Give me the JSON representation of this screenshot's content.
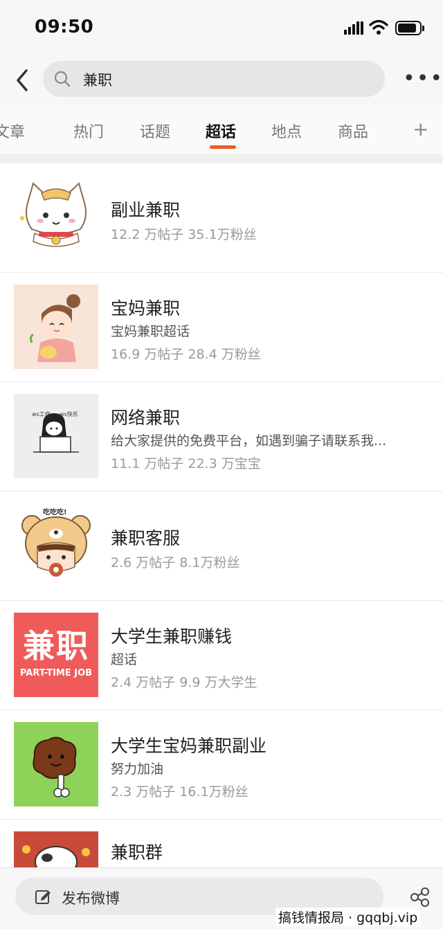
{
  "status_bar": {
    "time": "09:50"
  },
  "search": {
    "query": "兼职"
  },
  "tabs": [
    {
      "label": "文章"
    },
    {
      "label": "热门"
    },
    {
      "label": "话题"
    },
    {
      "label": "超话",
      "active": true
    },
    {
      "label": "地点"
    },
    {
      "label": "商品"
    }
  ],
  "results": [
    {
      "name": "副业兼职",
      "desc": "",
      "stats": "12.2 万帖子 35.1万粉丝",
      "thumb_icon": "cat-mascot-icon"
    },
    {
      "name": "宝妈兼职",
      "desc": "宝妈兼职超话",
      "stats": "16.9 万帖子 28.4 万粉丝",
      "thumb_icon": "mom-cartoon-icon"
    },
    {
      "name": "网络兼职",
      "desc": "给大家提供的免费平台，如遇到骗子请联系我...",
      "stats": "11.1 万帖子 22.3 万宝宝",
      "thumb_icon": "girl-sketch-icon",
      "thumb_text_left": "ws工作",
      "thumb_text_right": "ws快乐"
    },
    {
      "name": "兼职客服",
      "desc": "",
      "stats": "2.6 万帖子 8.1万粉丝",
      "thumb_icon": "bear-hood-kid-icon",
      "thumb_text": "吃吃吃!"
    },
    {
      "name": "大学生兼职赚钱",
      "desc": "超话",
      "stats": "2.4 万帖子 9.9 万大学生",
      "thumb_icon": "part-time-job-logo",
      "thumb_big": "兼职",
      "thumb_small": "PART-TIME JOB"
    },
    {
      "name": "大学生宝妈兼职副业",
      "desc": "努力加油",
      "stats": "2.3 万帖子 16.1万粉丝",
      "thumb_icon": "meat-drumstick-icon"
    },
    {
      "name": "兼职群",
      "desc": "",
      "stats": "",
      "thumb_icon": "cow-cartoon-icon"
    }
  ],
  "bottom_bar": {
    "post_label": "发布微博"
  },
  "watermark": "搞钱情报局 · gqqbj.vip",
  "colors": {
    "accent": "#ee5a24",
    "job_logo_bg": "#ef5a5a",
    "drumstick_bg": "#8ed25a"
  }
}
